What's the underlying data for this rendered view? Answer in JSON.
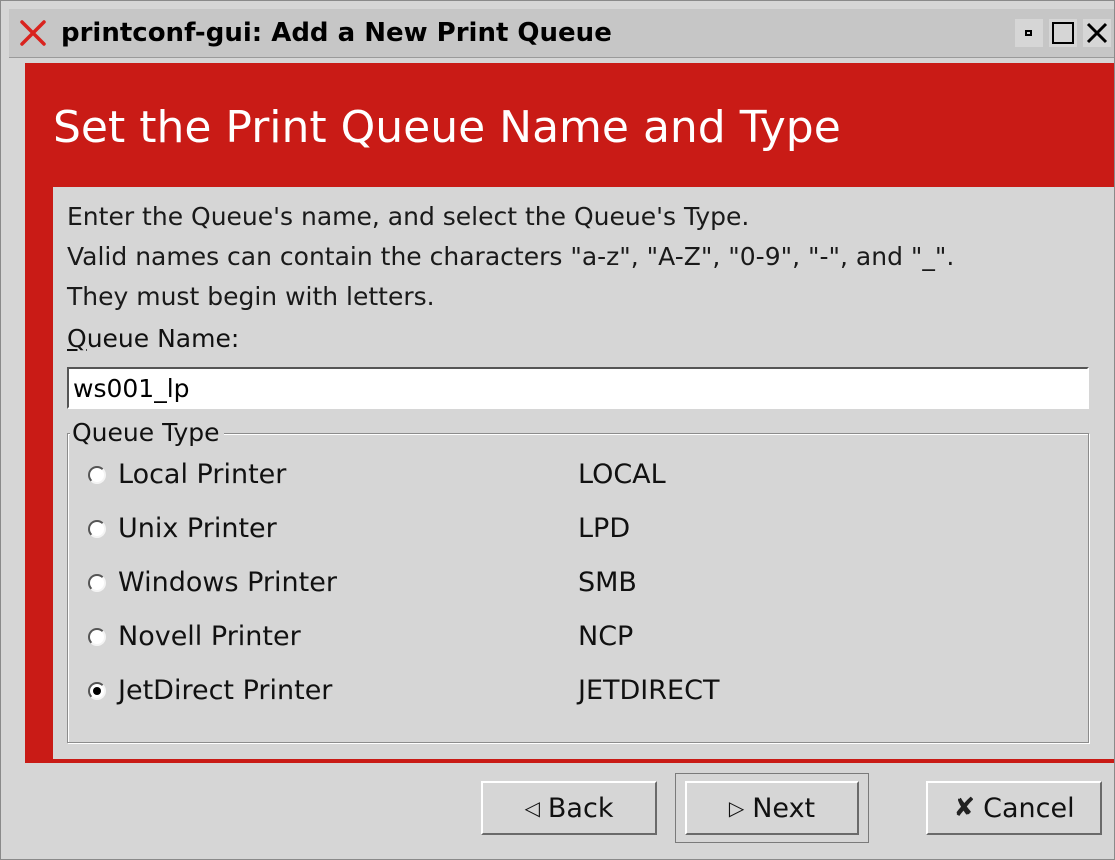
{
  "window": {
    "title": "printconf-gui: Add a New Print Queue"
  },
  "header": {
    "title": "Set the Print Queue Name and Type"
  },
  "instructions": {
    "line1": "Enter the Queue's name, and select the Queue's Type.",
    "line2": "Valid names can contain the characters \"a-z\", \"A-Z\", \"0-9\", \"-\", and \"_\".",
    "line3": "They must begin with letters."
  },
  "queue_name": {
    "label_mnemonic": "Q",
    "label_rest": "ueue Name:",
    "value": "ws001_lp"
  },
  "queue_type": {
    "legend": "Queue Type",
    "options": [
      {
        "label": "Local Printer",
        "code": "LOCAL",
        "selected": false
      },
      {
        "label": "Unix Printer",
        "code": "LPD",
        "selected": false
      },
      {
        "label": "Windows Printer",
        "code": "SMB",
        "selected": false
      },
      {
        "label": "Novell Printer",
        "code": "NCP",
        "selected": false
      },
      {
        "label": "JetDirect Printer",
        "code": "JETDIRECT",
        "selected": true
      }
    ]
  },
  "buttons": {
    "back_label": "Back",
    "back_icon": "left-triangle-icon",
    "next_label": "Next",
    "next_icon": "right-triangle-icon",
    "cancel_label": "Cancel",
    "cancel_icon": "cancel-x-icon"
  },
  "colors": {
    "header_red": "#c91b16",
    "panel_gray": "#d6d6d6",
    "close_red": "#d9231e"
  }
}
